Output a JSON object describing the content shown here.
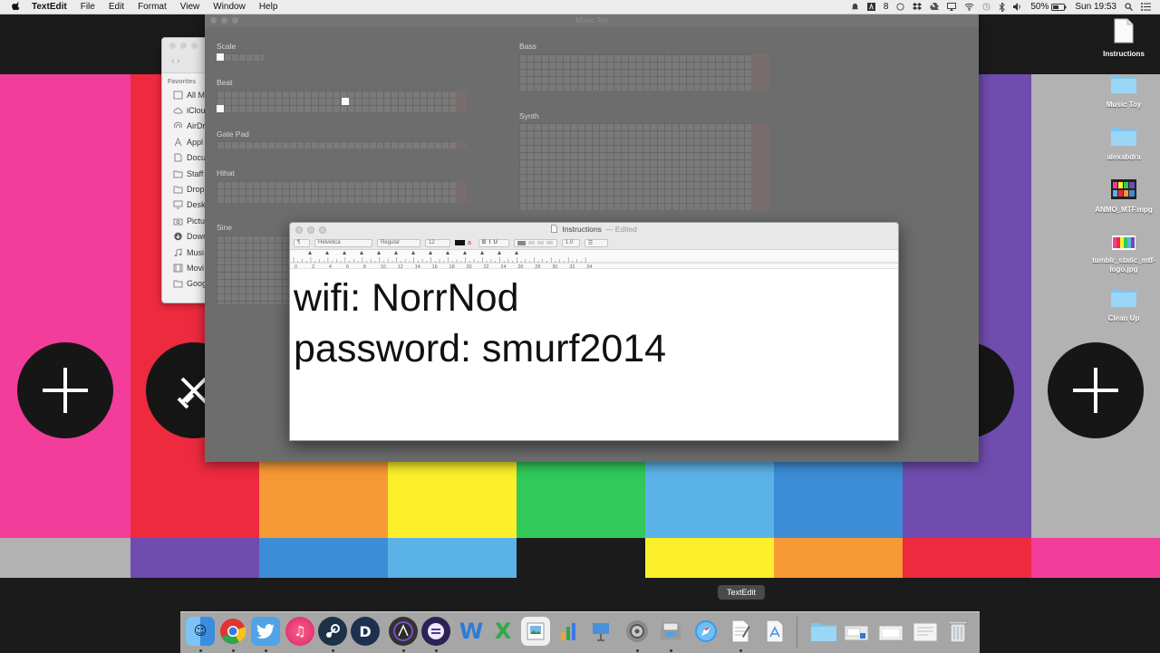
{
  "menubar": {
    "app_name": "TextEdit",
    "items": [
      "File",
      "Edit",
      "Format",
      "View",
      "Window",
      "Help"
    ],
    "status": {
      "user_count": "8",
      "battery": "50%",
      "clock": "Sun 19:53"
    }
  },
  "desktop_icons": [
    {
      "label": "Instructions",
      "icon": "document-icon"
    },
    {
      "label": "Music Toy",
      "icon": "folder-icon"
    },
    {
      "label": "alexabdra",
      "icon": "folder-icon"
    },
    {
      "label": "ANMO_MTF.mpg",
      "icon": "video-file-icon"
    },
    {
      "label": "tumblr_static_mtf-logo.jpg",
      "icon": "image-file-icon"
    },
    {
      "label": "Clean Up",
      "icon": "folder-icon"
    }
  ],
  "finder": {
    "section": "Favorites",
    "items": [
      "All M",
      "iClou",
      "AirDr",
      "Appl",
      "Docu",
      "Staff",
      "Drop",
      "Desk",
      "Pictu",
      "Down",
      "Musi",
      "Movi",
      "Goog"
    ]
  },
  "music_toy": {
    "title": "Music Toy",
    "instruments": [
      "Scale",
      "Beat",
      "Gate Pad",
      "Hihat",
      "Sine",
      "Bass",
      "Synth"
    ]
  },
  "textedit": {
    "title": "Instructions",
    "status": "— Edited",
    "font": "Helvetica",
    "style": "Regular",
    "size": "12",
    "ruler_labels": [
      "0",
      "2",
      "4",
      "6",
      "8",
      "10",
      "12",
      "14",
      "16",
      "18",
      "20",
      "22",
      "24",
      "26",
      "28",
      "30",
      "32",
      "34"
    ],
    "lines": [
      "wifi: NorrNod",
      "password: smurf2014"
    ]
  },
  "dock": {
    "tooltip": "TextEdit",
    "apps": [
      "Finder",
      "Chrome",
      "Twitter",
      "iTunes",
      "Steam",
      "Dashboard",
      "Logic",
      "Eclipse",
      "Word",
      "Excel",
      "Preview",
      "Numbers",
      "Keynote",
      "System Preferences",
      "Image Capture",
      "Safari",
      "TextEdit",
      "App Store",
      "Downloads",
      "Documents",
      "Desktop",
      "Files",
      "Trash"
    ]
  },
  "colors": {
    "pink": "#f23d9a",
    "red": "#ee2a3f",
    "orange": "#f79a35",
    "yellow": "#fbf02a",
    "green": "#30c95a",
    "light_blue": "#5ab2e7",
    "blue": "#3d8dd6",
    "purple": "#6f4cae",
    "grey": "#b2b2b2"
  }
}
